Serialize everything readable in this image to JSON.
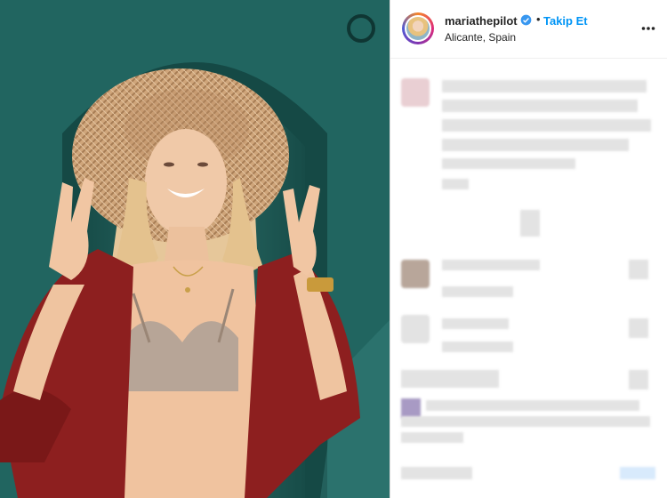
{
  "post": {
    "username": "mariathepilot",
    "separator": "•",
    "follow_label": "Takip Et",
    "location": "Alicante, Spain"
  },
  "icons": {
    "verified": "verified-badge-icon",
    "more": "more-options-icon"
  },
  "colors": {
    "follow_blue": "#0095f6",
    "verified_blue": "#3897f0",
    "photo_background": "#1f5b57"
  }
}
